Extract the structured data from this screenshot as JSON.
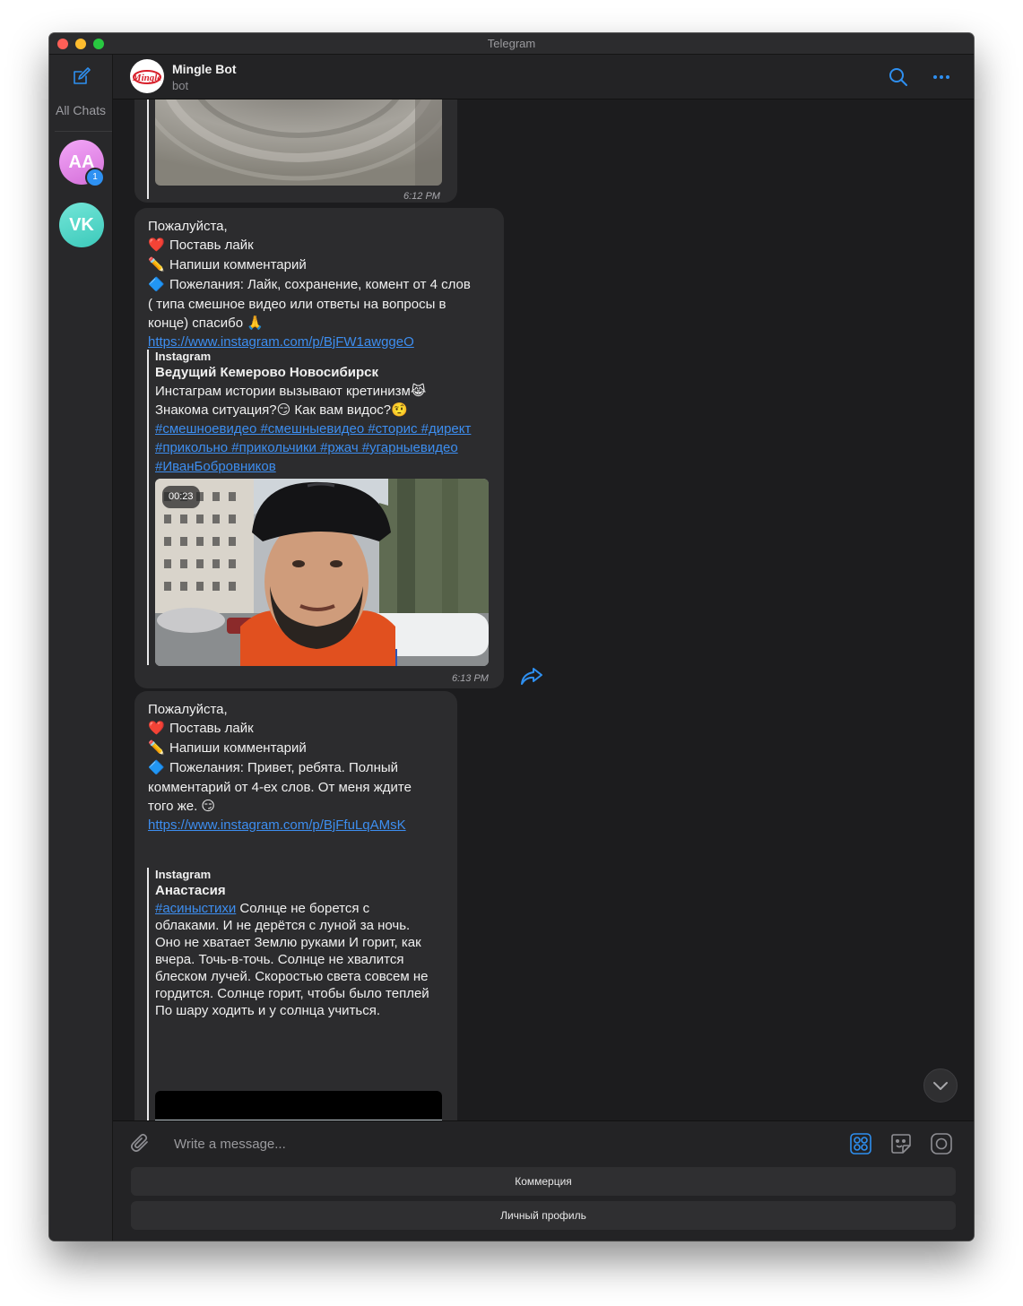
{
  "window": {
    "title": "Telegram"
  },
  "sidebar": {
    "all_chats_label": "All Chats",
    "chats": [
      {
        "initials": "AA",
        "unread": "1",
        "color": "#e78ee9"
      },
      {
        "initials": "VK",
        "color": "#55d6c8"
      }
    ]
  },
  "header": {
    "name": "Mingle Bot",
    "subtitle": "bot",
    "logo_text": "Mingle"
  },
  "messages": [
    {
      "time": "6:12 PM"
    },
    {
      "lines": [
        "Пожалуйста,",
        "Поставь лайк",
        "Напиши комментарий",
        "Пожелания: Лайк, сохранение, комент от 4 слов",
        "( типа смешное видео или ответы на вопросы в",
        "конце) спасибо 🙏"
      ],
      "link": "https://www.instagram.com/p/BjFW1awggeO",
      "preview": {
        "site": "Instagram",
        "title": "Ведущий Кемерово Новосибирск",
        "desc": [
          "Инстаграм истории вызывают кретинизм😹",
          "Знакома ситуация?😏 Как вам видос?🤨"
        ],
        "tags": [
          "#смешноевидео #смешныевидео #сторис #директ",
          "#прикольно #прикольчики #ржач #угарныевидео",
          "#ИванБобровников"
        ],
        "video_duration": "00:23"
      },
      "time": "6:13 PM"
    },
    {
      "lines": [
        "Пожалуйста,",
        "Поставь лайк",
        "Напиши комментарий",
        "Пожелания: Привет, ребята. Полный",
        "комментарий от 4-ех слов. От меня ждите",
        "того же. 😏"
      ],
      "link": "https://www.instagram.com/p/BjFfuLqAMsK",
      "preview": {
        "site": "Instagram",
        "title": "Анастасия",
        "tag": "#асиныстихи",
        "desc_first": " Солнце не борется с",
        "desc": [
          "облаками. И не дерётся с луной за ночь.",
          "Оно не хватает Землю руками И горит, как",
          "вчера. Точь-в-точь. Солнце не хвалится",
          "блеском лучей. Скоростью света совсем не",
          "гордится. Солнце горит, чтобы было теплей",
          "По шару ходить и у солнца учиться."
        ]
      }
    }
  ],
  "icons": {
    "heart": "❤️",
    "pencil": "✏️",
    "diamond": "🔷"
  },
  "composer": {
    "placeholder": "Write a message...",
    "keyboard_buttons": [
      "Коммерция",
      "Личный профиль"
    ]
  },
  "colors": {
    "accent": "#3d8ef0",
    "background": "#1c1c1e",
    "bubble": "#2c2c2e"
  }
}
